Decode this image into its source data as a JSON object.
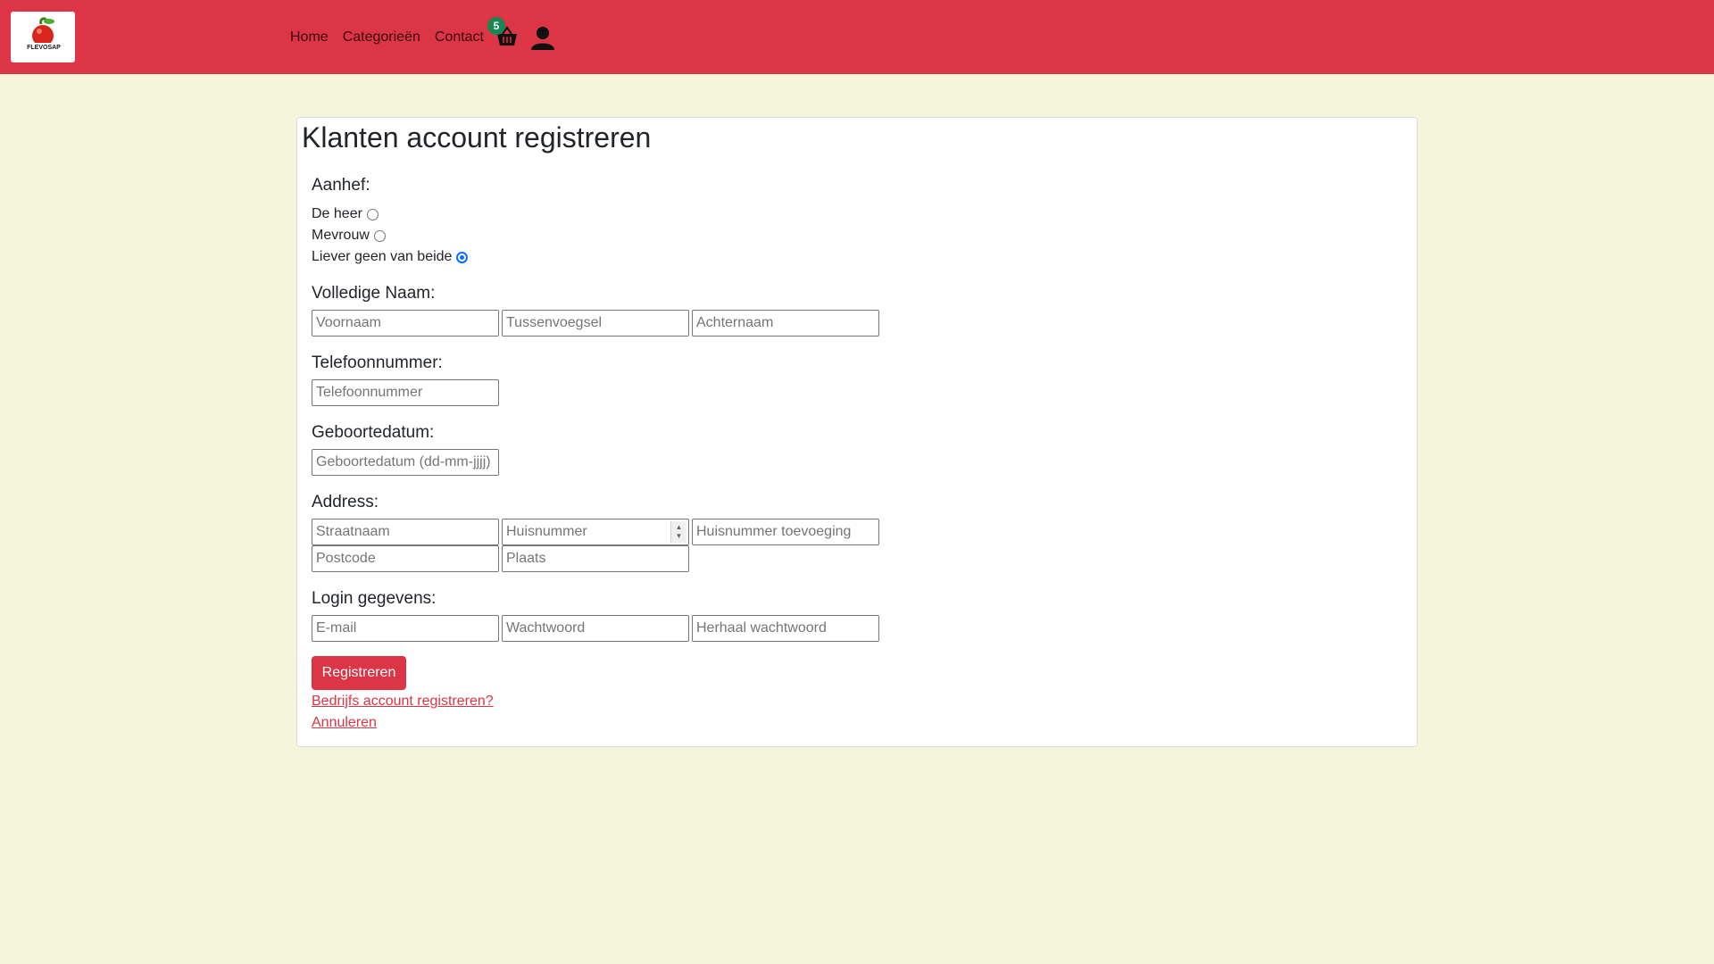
{
  "nav": {
    "logo_text": "FLEVOSAP",
    "links": [
      "Home",
      "Categorieën",
      "Contact"
    ],
    "cart_count": "5",
    "brand_color": "#dc3545",
    "icons": [
      "basket-icon",
      "user-icon"
    ]
  },
  "form": {
    "title": "Klanten account registreren",
    "salutation": {
      "label": "Aanhef:",
      "options": [
        "De heer",
        "Mevrouw",
        "Liever geen van beide"
      ],
      "selected": "Liever geen van beide"
    },
    "name": {
      "label": "Volledige Naam:",
      "first_placeholder": "Voornaam",
      "middle_placeholder": "Tussenvoegsel",
      "last_placeholder": "Achternaam"
    },
    "phone": {
      "label": "Telefoonnummer:",
      "placeholder": "Telefoonnummer"
    },
    "birthdate": {
      "label": "Geboortedatum:",
      "placeholder": "Geboortedatum (dd-mm-jjjj)"
    },
    "address": {
      "label": "Address:",
      "street_placeholder": "Straatnaam",
      "number_placeholder": "Huisnummer",
      "addition_placeholder": "Huisnummer toevoeging",
      "postcode_placeholder": "Postcode",
      "city_placeholder": "Plaats"
    },
    "login": {
      "label": "Login gegevens:",
      "email_placeholder": "E-mail",
      "password_placeholder": "Wachtwoord",
      "repeat_placeholder": "Herhaal wachtwoord"
    },
    "submit_label": "Registreren",
    "business_link": "Bedrijfs account registreren?",
    "cancel_link": "Annuleren"
  }
}
